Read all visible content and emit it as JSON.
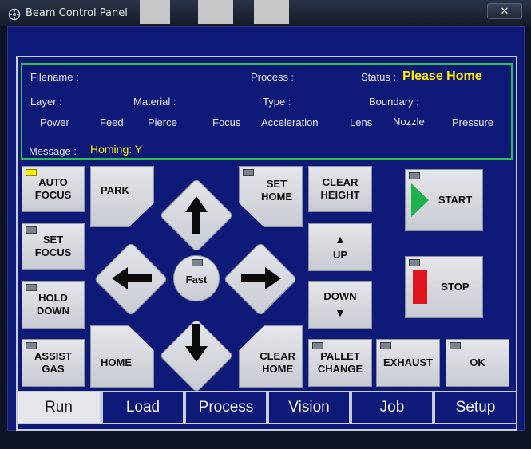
{
  "window": {
    "title": "Beam Control Panel",
    "close_glyph": "✕"
  },
  "info": {
    "filename_label": "Filename :",
    "process_label": "Process :",
    "status_label": "Status :",
    "status_value": "Please Home",
    "layer_label": "Layer :",
    "material_label": "Material :",
    "type_label": "Type :",
    "boundary_label": "Boundary :",
    "columns": [
      "Power",
      "Feed",
      "Pierce",
      "Focus",
      "Acceleration",
      "Lens",
      "Nozzle",
      "Pressure"
    ],
    "message_label": "Message :",
    "message_value": "Homing: Y"
  },
  "buttons": {
    "auto_focus": "AUTO\nFOCUS",
    "set_focus": "SET\nFOCUS",
    "hold_down": "HOLD\nDOWN",
    "assist_gas": "ASSIST\nGAS",
    "park": "PARK",
    "home": "HOME",
    "set_home": "SET\nHOME",
    "clear_home": "CLEAR\nHOME",
    "fast": "Fast",
    "clear_height": "CLEAR\nHEIGHT",
    "up": "UP",
    "up_glyph": "▲",
    "down": "DOWN",
    "down_glyph": "▼",
    "pallet_change": "PALLET\nCHANGE",
    "exhaust": "EXHAUST",
    "start": "START",
    "stop": "STOP",
    "ok": "OK"
  },
  "tabs": [
    "Run",
    "Load",
    "Process",
    "Vision",
    "Job",
    "Setup"
  ],
  "colors": {
    "panel": "#0f1a78",
    "status_yellow": "#ffee00",
    "start_green": "#1db34a",
    "stop_red": "#e0141c",
    "info_border": "#2fbf4f"
  }
}
